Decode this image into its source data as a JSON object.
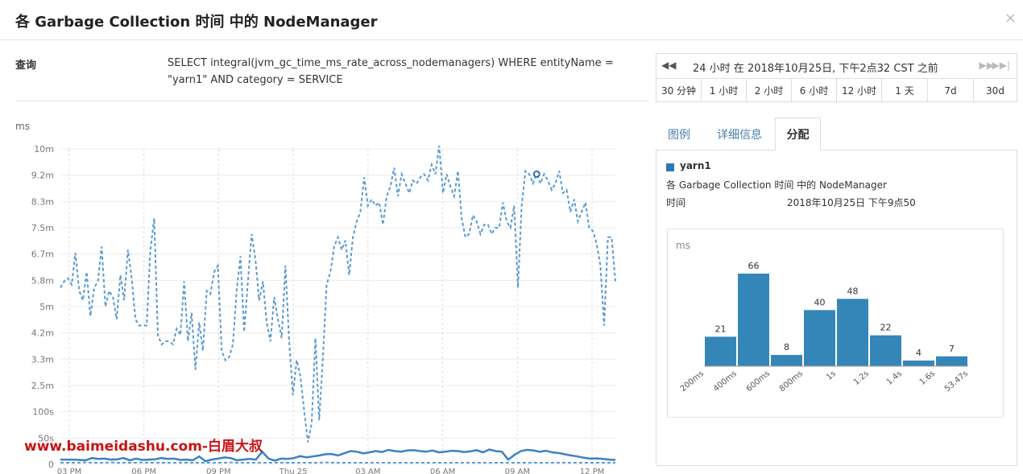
{
  "dialog": {
    "title": "各 Garbage Collection 时间 中的 NodeManager",
    "close_icon": "×"
  },
  "query": {
    "label": "查询",
    "text": "SELECT integral(jvm_gc_time_ms_rate_across_nodemanagers) WHERE entityName = \"yarn1\" AND category = SERVICE"
  },
  "time_controls": {
    "prev_icon": "◀◀",
    "range_text": "24 小时 在 2018年10月25日, 下午2点32 CST 之前",
    "next_icon": "▶▶",
    "last_icon": "▶▶|",
    "buttons": [
      "30 分钟",
      "1 小时",
      "2 小时",
      "6 小时",
      "12 小时",
      "1 天",
      "7d",
      "30d"
    ]
  },
  "tabs": {
    "items": [
      "图例",
      "详细信息",
      "分配"
    ],
    "active": "分配"
  },
  "details": {
    "series_name": "yarn1",
    "series_color": "#2f78b7",
    "description": "各 Garbage Collection 时间 中的 NodeManager",
    "time_label": "时间",
    "time_value": "2018年10月25日 下午9点50"
  },
  "watermark": "www.baimeidashu.com-白眉大叔",
  "chart_data": [
    {
      "type": "line",
      "ylabel": "ms",
      "yticks": [
        "0",
        "50s",
        "100s",
        "2.5m",
        "3.3m",
        "4.2m",
        "5m",
        "5.8m",
        "6.7m",
        "7.5m",
        "8.3m",
        "9.2m",
        "10m"
      ],
      "xticks": [
        "03 PM",
        "06 PM",
        "09 PM",
        "Thu 25",
        "03 AM",
        "06 AM",
        "09 AM",
        "12 PM"
      ],
      "series": [
        {
          "style": "dashed",
          "color": "#5b9bd1",
          "values": [
            5.6,
            5.8,
            5.9,
            5.7,
            6.7,
            5.5,
            5.2,
            6.1,
            4.7,
            5.6,
            5.8,
            6.9,
            5.0,
            5.5,
            5.3,
            4.6,
            6.0,
            5.2,
            6.8,
            5.9,
            4.6,
            4.4,
            4.4,
            4.4,
            6.8,
            7.8,
            4.1,
            3.8,
            3.9,
            3.9,
            3.8,
            4.3,
            4.1,
            5.8,
            3.9,
            4.8,
            3.0,
            4.5,
            3.6,
            5.5,
            5.4,
            6.1,
            6.3,
            3.6,
            3.3,
            3.4,
            3.8,
            5.5,
            6.6,
            4.2,
            5.8,
            7.3,
            6.5,
            5.2,
            5.8,
            4.5,
            3.9,
            5.3,
            4.6,
            4.0,
            6.3,
            3.9,
            2.2,
            3.3,
            2.8,
            1.7,
            0.7,
            1.3,
            4.0,
            1.4,
            3.4,
            5.7,
            6.1,
            6.9,
            7.2,
            6.8,
            7.1,
            6.0,
            7.2,
            7.7,
            8.0,
            9.1,
            8.2,
            8.4,
            8.2,
            8.3,
            7.6,
            8.5,
            8.8,
            9.4,
            8.5,
            9.2,
            8.9,
            8.6,
            9.0,
            8.9,
            9.1,
            9.2,
            9.0,
            9.5,
            9.2,
            10.1,
            8.6,
            9.2,
            8.8,
            8.5,
            9.3,
            7.8,
            7.2,
            7.3,
            7.9,
            7.7,
            7.3,
            7.6,
            7.6,
            7.3,
            7.5,
            7.5,
            8.3,
            7.7,
            7.5,
            8.2,
            5.6,
            8.2,
            9.3,
            9.2,
            8.9,
            9.2,
            8.9,
            9.2,
            9.0,
            8.7,
            8.9,
            9.3,
            8.6,
            8.7,
            8.0,
            8.4,
            7.7,
            8.0,
            8.3,
            7.5,
            7.4,
            7.0,
            6.3,
            4.4,
            7.2,
            7.2,
            5.8
          ]
        },
        {
          "style": "solid",
          "color": "#3a82c4",
          "values": [
            0.15,
            0.15,
            0.15,
            0.14,
            0.13,
            0.2,
            0.17,
            0.18,
            0.15,
            0.16,
            0.2,
            0.13,
            0.18,
            0.14,
            0.15,
            0.16,
            0.2,
            0.17,
            0.18,
            0.14,
            0.15,
            0.13,
            0.25,
            0.1,
            0.15,
            0.18,
            0.22,
            0.2,
            0.13,
            0.15,
            0.17,
            0.15,
            0.4,
            0.18,
            0.12,
            0.18,
            0.17,
            0.2,
            0.26,
            0.22,
            0.25,
            0.28,
            0.32,
            0.33,
            0.28,
            0.35,
            0.42,
            0.4,
            0.35,
            0.38,
            0.42,
            0.39,
            0.46,
            0.42,
            0.4,
            0.44,
            0.45,
            0.42,
            0.4,
            0.44,
            0.38,
            0.4,
            0.43,
            0.42,
            0.39,
            0.41,
            0.45,
            0.38,
            0.47,
            0.42,
            0.4,
            0.15,
            0.3,
            0.42,
            0.46,
            0.44,
            0.4,
            0.43,
            0.38,
            0.36,
            0.32,
            0.28,
            0.25,
            0.21,
            0.18,
            0.19,
            0.17,
            0.15,
            0.14
          ]
        },
        {
          "style": "dashed",
          "color": "#5b9bd1",
          "values": [
            0.05,
            0.05,
            0.05,
            0.05,
            0.06,
            0.05,
            0.05,
            0.05,
            0.06,
            0.05,
            0.05,
            0.05,
            0.05,
            0.06,
            0.05,
            0.05,
            0.05,
            0.05,
            0.05,
            0.05,
            0.05,
            0.05,
            0.05,
            0.05,
            0.05,
            0.05,
            0.05,
            0.06,
            0.05,
            0.05,
            0.05,
            0.05,
            0.05,
            0.05,
            0.05,
            0.05,
            0.05,
            0.05,
            0.05,
            0.05,
            0.05,
            0.05,
            0.06,
            0.05,
            0.05,
            0.05,
            0.05,
            0.05,
            0.05,
            0.05,
            0.05,
            0.05,
            0.05,
            0.05,
            0.05,
            0.05,
            0.05,
            0.05,
            0.05,
            0.05,
            0.05,
            0.05,
            0.05,
            0.05,
            0.05,
            0.05,
            0.05,
            0.05,
            0.05,
            0.05,
            0.05,
            0.05,
            0.05,
            0.05,
            0.05,
            0.05,
            0.05,
            0.05,
            0.05,
            0.05,
            0.05,
            0.05,
            0.05,
            0.05,
            0.05,
            0.05,
            0.05,
            0.05,
            0.05
          ]
        }
      ],
      "highlight_index": 127
    },
    {
      "type": "bar",
      "ylabel": "ms",
      "categories": [
        "200ms",
        "400ms",
        "600ms",
        "800ms",
        "1s",
        "1.2s",
        "1.4s",
        "1.6s",
        "53.47s"
      ],
      "values": [
        21,
        66,
        8,
        40,
        48,
        22,
        4,
        7
      ],
      "color": "#3586b8"
    }
  ]
}
